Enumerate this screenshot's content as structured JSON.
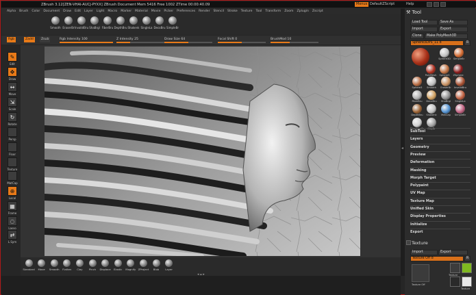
{
  "titlebar": {
    "title": "ZBrush 3.12[ZEN-VHAI-AUCJ-PYXX]   ZBrush Document   Mem 5416  Free 1002  ZTime 00:00:40.09",
    "menus_btn": "Menus",
    "default_script": "DefaultZScript",
    "help": "Help"
  },
  "menubar": [
    "Alpha",
    "Brush",
    "Color",
    "Document",
    "Draw",
    "Edit",
    "Layer",
    "Light",
    "Macro",
    "Marker",
    "Material",
    "Movie",
    "Picker",
    "Preferences",
    "Render",
    "Stencil",
    "Stroke",
    "Texture",
    "Tool",
    "Transform",
    "Zoom",
    "Zplugin",
    "Zscript"
  ],
  "top_brushes": [
    "Smooth",
    "EraserBr",
    "InvalidBru",
    "ShaBrgl",
    "FiberBru",
    "DepthBru",
    "Shakenk",
    "SingleLa",
    "DecoBru",
    "SimpleBr"
  ],
  "controls": {
    "rgb": "Rgb",
    "zadd": "Zadd",
    "zsub": "Zsub",
    "rgb_intensity": {
      "label": "Rgb Intensity",
      "value": "100",
      "fraction": 1.0
    },
    "z_intensity": {
      "label": "Z Intensity",
      "value": "25",
      "fraction": 0.25
    },
    "draw_size": {
      "label": "Draw Size",
      "value": "64",
      "fraction": 0.5
    },
    "focal_shift": {
      "label": "Focal Shift",
      "value": "0",
      "fraction": 0.5
    },
    "brush_mod": {
      "label": "BrushMod",
      "value": "10",
      "fraction": 0.4
    }
  },
  "left_tools": [
    {
      "label": "Edit",
      "glyph": "✎",
      "on": true
    },
    {
      "label": "Draw",
      "glyph": "✥",
      "on": true
    },
    {
      "label": "Move",
      "glyph": "↔",
      "on": false
    },
    {
      "label": "Scale",
      "glyph": "⇲",
      "on": false
    },
    {
      "label": "Rotate",
      "glyph": "↻",
      "on": false
    },
    {
      "label": "Persp",
      "glyph": "",
      "on": false
    },
    {
      "label": "Floor",
      "glyph": "",
      "on": false
    },
    {
      "label": "Texture",
      "glyph": "",
      "on": false
    },
    {
      "label": "MatCap",
      "glyph": "",
      "on": false
    },
    {
      "label": "Local",
      "glyph": "⊕",
      "on": true
    },
    {
      "label": "Frame",
      "glyph": "▦",
      "on": false
    },
    {
      "label": "Lasso",
      "glyph": "◌",
      "on": false
    },
    {
      "label": "L.Sym",
      "glyph": "⇄",
      "on": false
    }
  ],
  "bottom_brushes": [
    "Standard",
    "Move",
    "Smooth",
    "Flatten",
    "Clay",
    "Pinch",
    "Displace",
    "Elastic",
    "Magnify",
    "ZProject",
    "Blob",
    "Layer"
  ],
  "arrows": "◂ ▴ ▸",
  "right_panel": {
    "title": "Tool",
    "load_tool": "Load Tool",
    "save_as": "Save As",
    "import": "Import",
    "export": "Export",
    "clone": "Clone",
    "make_polymesh": "Make PolyMesh3D",
    "current_tool": "Sphere3DPS_11",
    "current_tool_count": "8",
    "r_label": "R",
    "tool_thumbs": [
      "Sphere3D",
      "SimpleBr",
      "ZSphere",
      "PolyMesh",
      "Sphere3",
      "Sphere3",
      "Smooth",
      "EraserBr",
      "InvalidBru",
      "FiberBru",
      "DecoBru",
      "ShaBrgl",
      "SingleLa",
      "DepthBru",
      "Shakenk",
      "MatCap",
      "SimpleBr",
      "DirectionBr",
      "ClayBr"
    ],
    "sections": [
      "SubTool",
      "Layers",
      "Geometry",
      "Preview",
      "Deformation",
      "Masking",
      "Morph Target",
      "Polypaint",
      "UV Map",
      "Texture Map",
      "Unified Skin",
      "Display Properties",
      "Initialize",
      "Export"
    ],
    "texture_title": "Texture",
    "texture_import": "Import",
    "texture_export": "Export",
    "texture_off": "Texture Off",
    "texture_count": "8",
    "texture_r": "R",
    "texture_labels": [
      "Texture Off",
      "Texture",
      "Texture"
    ]
  }
}
